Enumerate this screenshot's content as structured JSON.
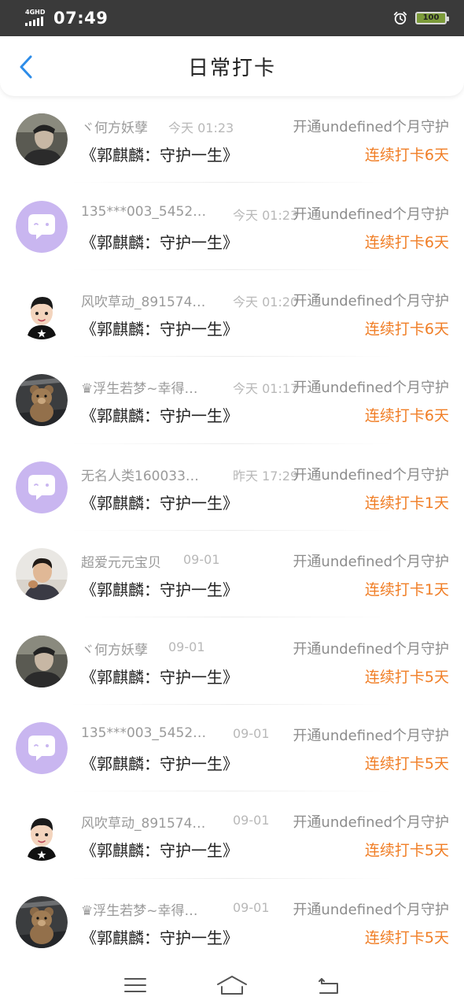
{
  "status_bar": {
    "network": "4GHD",
    "time": "07:49",
    "battery": "100",
    "icons": [
      "signal-icon",
      "alarm-icon",
      "battery-icon"
    ]
  },
  "header": {
    "title": "日常打卡",
    "back_icon": "chevron-left-icon"
  },
  "colors": {
    "accent_blue": "#2d8ce8",
    "streak_orange": "#f07e26",
    "avatar_default": "#c9b6f0"
  },
  "list": {
    "items": [
      {
        "name": "ヾ何方妖孽",
        "time": "今天 01:23",
        "note": "开通undefined个月守护",
        "song": "《郭麒麟：守护一生》",
        "streak": "连续打卡6天",
        "avatar": "photo-man-dark"
      },
      {
        "name": "135***003_5452…",
        "time": "今天 01:23",
        "note": "开通undefined个月守护",
        "song": "《郭麒麟：守护一生》",
        "streak": "连续打卡6天",
        "avatar": "default-chat-bubble"
      },
      {
        "name": "风吹草动_891574…",
        "time": "今天 01:20",
        "note": "开通undefined个月守护",
        "song": "《郭麒麟：守护一生》",
        "streak": "连续打卡6天",
        "avatar": "cartoon-boy"
      },
      {
        "name": "♛浮生若梦~幸得…",
        "time": "今天 01:17",
        "note": "开通undefined个月守护",
        "song": "《郭麒麟：守护一生》",
        "streak": "连续打卡6天",
        "avatar": "teddy-bear"
      },
      {
        "name": "无名人类160033…",
        "time": "昨天 17:29",
        "note": "开通undefined个月守护",
        "song": "《郭麒麟：守护一生》",
        "streak": "连续打卡1天",
        "avatar": "default-chat-bubble"
      },
      {
        "name": "超爱元元宝贝",
        "time": "09-01",
        "note": "开通undefined个月守护",
        "song": "《郭麒麟：守护一生》",
        "streak": "连续打卡1天",
        "avatar": "photo-boy"
      },
      {
        "name": "ヾ何方妖孽",
        "time": "09-01",
        "note": "开通undefined个月守护",
        "song": "《郭麒麟：守护一生》",
        "streak": "连续打卡5天",
        "avatar": "photo-man-dark"
      },
      {
        "name": "135***003_5452…",
        "time": "09-01",
        "note": "开通undefined个月守护",
        "song": "《郭麒麟：守护一生》",
        "streak": "连续打卡5天",
        "avatar": "default-chat-bubble"
      },
      {
        "name": "风吹草动_891574…",
        "time": "09-01",
        "note": "开通undefined个月守护",
        "song": "《郭麒麟：守护一生》",
        "streak": "连续打卡5天",
        "avatar": "cartoon-boy"
      },
      {
        "name": "♛浮生若梦~幸得…",
        "time": "09-01",
        "note": "开通undefined个月守护",
        "song": "《郭麒麟：守护一生》",
        "streak": "连续打卡5天",
        "avatar": "teddy-bear"
      }
    ]
  },
  "nav_bar": {
    "icons": [
      "menu-icon",
      "home-icon",
      "back-icon"
    ]
  }
}
